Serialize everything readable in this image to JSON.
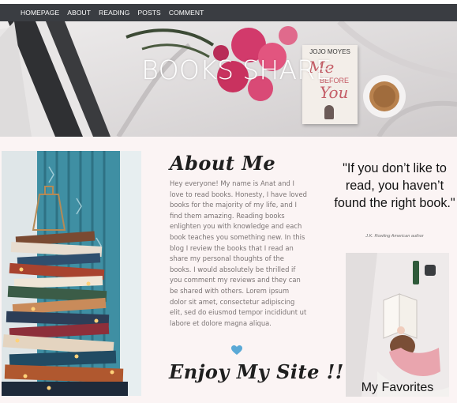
{
  "nav": {
    "items": [
      {
        "label": "HOMEPAGE"
      },
      {
        "label": "ABOUT"
      },
      {
        "label": "READING"
      },
      {
        "label": "POSTS"
      },
      {
        "label": "COMMENT"
      }
    ]
  },
  "hero": {
    "title": "BOOKS SHARE",
    "book_cover_author": "JOJO MOYES",
    "book_cover_title_1": "Me",
    "book_cover_title_2": "BEFORE",
    "book_cover_title_3": "You"
  },
  "about": {
    "heading": "About Me",
    "body": "Hey everyone! My name is Anat and I love to read books. Honesty, I have loved books for the majority of my life, and I find them amazing. Reading books enlighten you with knowledge and each book teaches you something new. In this blog I review the books that I read an share my personal thoughts of the books. I would absolutely be thrilled if you comment my reviews and they can be shared with others. Lorem ipsum dolor sit amet, consectetur adipiscing elit, sed do eiusmod tempor incididunt ut labore et dolore magna aliqua.",
    "closing": "Enjoy My Site !!"
  },
  "quote": {
    "text": "\"If you don’t like to read, you haven’t found the right book.\"",
    "author": "J.K. Rowling American author"
  },
  "favorites": {
    "label": "My Favorites"
  },
  "colors": {
    "nav_bg": "#3a3d42",
    "page_bg": "#fbf4f4",
    "heart": "#5aa9d6"
  }
}
